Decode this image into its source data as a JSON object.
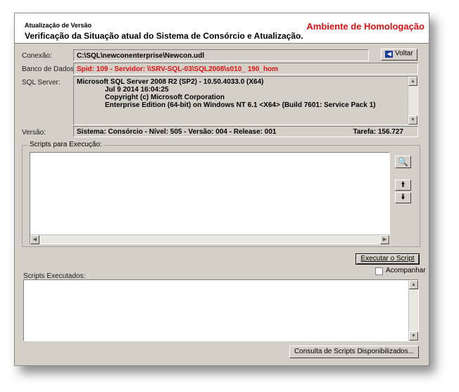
{
  "header": {
    "small_title": "Atualização de Versão",
    "title": "Verificação da Situação atual do Sistema de Consórcio e Atualização.",
    "environment": "Ambiente de Homologação"
  },
  "conexao": {
    "label": "Conexão:",
    "value": "C:\\SQL\\newconenterprise\\Newcon.udl"
  },
  "voltar_button": {
    "label": "Voltar"
  },
  "banco": {
    "label": "Banco de Dados:",
    "value": "Spid: 109 - Servidor: \\\\SRV-SQL-03\\SQL2008\\s010_   190_hom",
    "color": "#e01010"
  },
  "sql_server": {
    "label": "SQL Server:",
    "lines": [
      "Microsoft SQL Server 2008 R2 (SP2) - 10.50.4033.0 (X64)",
      "Jul  9 2014 16:04:25",
      "Copyright (c) Microsoft Corporation",
      "Enterprise Edition (64-bit) on Windows NT 6.1 <X64> (Build 7601: Service Pack 1)"
    ]
  },
  "versao": {
    "label": "Versão:",
    "value": "Sistema: Consórcio  -  Nível: 505 - Versão: 004 - Release: 001",
    "tarefa": "Tarefa: 156.727"
  },
  "scripts_execucao": {
    "title": "Scripts para Execução:"
  },
  "executar_button": {
    "label": "Executar o Script"
  },
  "acompanhar": {
    "label": "Acompanhar",
    "checked": false
  },
  "scripts_executados": {
    "label": "Scripts Executados:"
  },
  "consulta_button": {
    "label": "Consulta de Scripts Disponibilizados..."
  }
}
